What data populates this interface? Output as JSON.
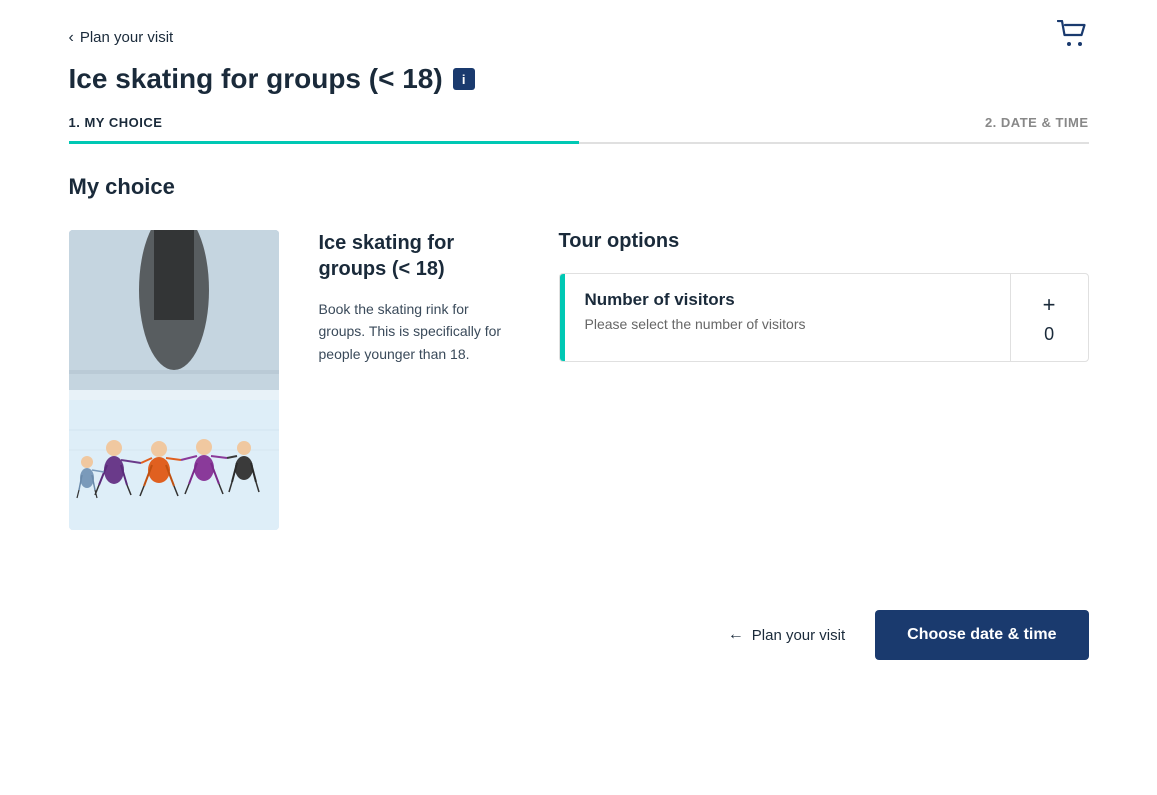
{
  "nav": {
    "back_label": "Plan your visit"
  },
  "page": {
    "title": "Ice skating for groups (< 18)",
    "info_icon": "i"
  },
  "steps": {
    "step1_label": "1. MY CHOICE",
    "step2_label": "2. DATE & TIME"
  },
  "section": {
    "title": "My choice"
  },
  "activity": {
    "name": "Ice skating for groups (< 18)",
    "description": "Book the skating rink for groups. This is specifically for people younger than 18."
  },
  "tour_options": {
    "title": "Tour options",
    "visitor_label": "Number of visitors",
    "visitor_hint": "Please select the number of visitors",
    "count": "0",
    "plus_symbol": "+"
  },
  "footer": {
    "back_label": "Plan your visit",
    "choose_label": "Choose date & time"
  }
}
